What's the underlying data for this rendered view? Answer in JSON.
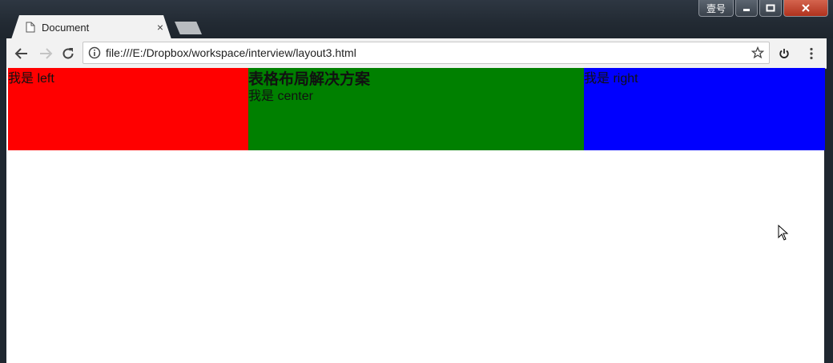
{
  "window": {
    "user_label": "壹号"
  },
  "tab": {
    "title": "Document",
    "close": "×"
  },
  "address_bar": {
    "url": "file:///E:/Dropbox/workspace/interview/layout3.html"
  },
  "page": {
    "left": {
      "text": "我是 left",
      "color": "#ff0000"
    },
    "center": {
      "heading": "表格布局解决方案",
      "text": "我是 center",
      "color": "#008000"
    },
    "right": {
      "text": "我是 right",
      "color": "#0000ff"
    }
  }
}
